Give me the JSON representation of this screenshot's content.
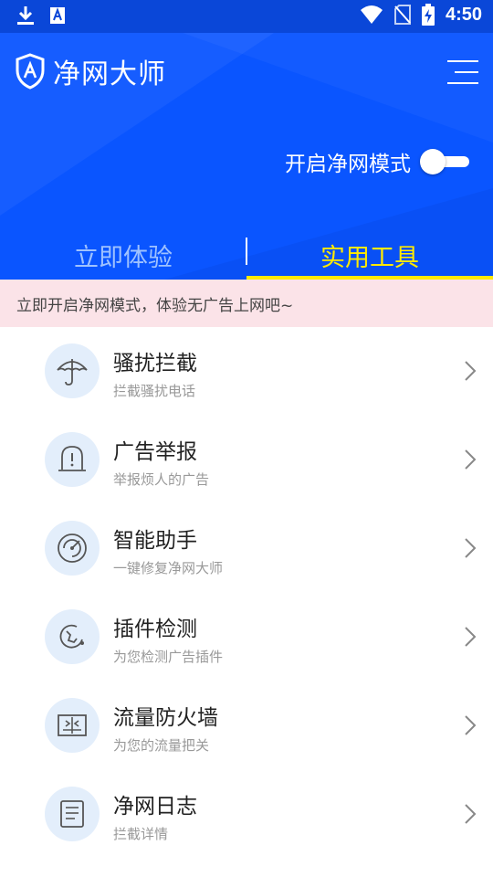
{
  "status_bar": {
    "time": "4:50",
    "left_icons": [
      "download-icon",
      "font-a-icon"
    ],
    "right_icons": [
      "wifi-icon",
      "no-sim-icon",
      "battery-charging-icon"
    ]
  },
  "header": {
    "app_title": "净网大师",
    "logo_icon": "shield-logo-icon",
    "menu_icon": "menu-icon",
    "background_color": "#0a55ff",
    "mode_label": "开启净网模式",
    "mode_enabled": false
  },
  "tabs": [
    {
      "label": "立即体验",
      "active": false
    },
    {
      "label": "实用工具",
      "active": true
    }
  ],
  "accent_color": "#ffea00",
  "notice": "立即开启净网模式，体验无广告上网吧~",
  "tools": [
    {
      "title": "骚扰拦截",
      "subtitle": "拦截骚扰电话",
      "icon": "umbrella-icon"
    },
    {
      "title": "广告举报",
      "subtitle": "举报烦人的广告",
      "icon": "alarm-icon"
    },
    {
      "title": "智能助手",
      "subtitle": "一键修复净网大师",
      "icon": "radar-icon"
    },
    {
      "title": "插件检测",
      "subtitle": "为您检测广告插件",
      "icon": "plugin-scan-icon"
    },
    {
      "title": "流量防火墙",
      "subtitle": "为您的流量把关",
      "icon": "firewall-icon"
    },
    {
      "title": "净网日志",
      "subtitle": "拦截详情",
      "icon": "log-icon"
    }
  ]
}
